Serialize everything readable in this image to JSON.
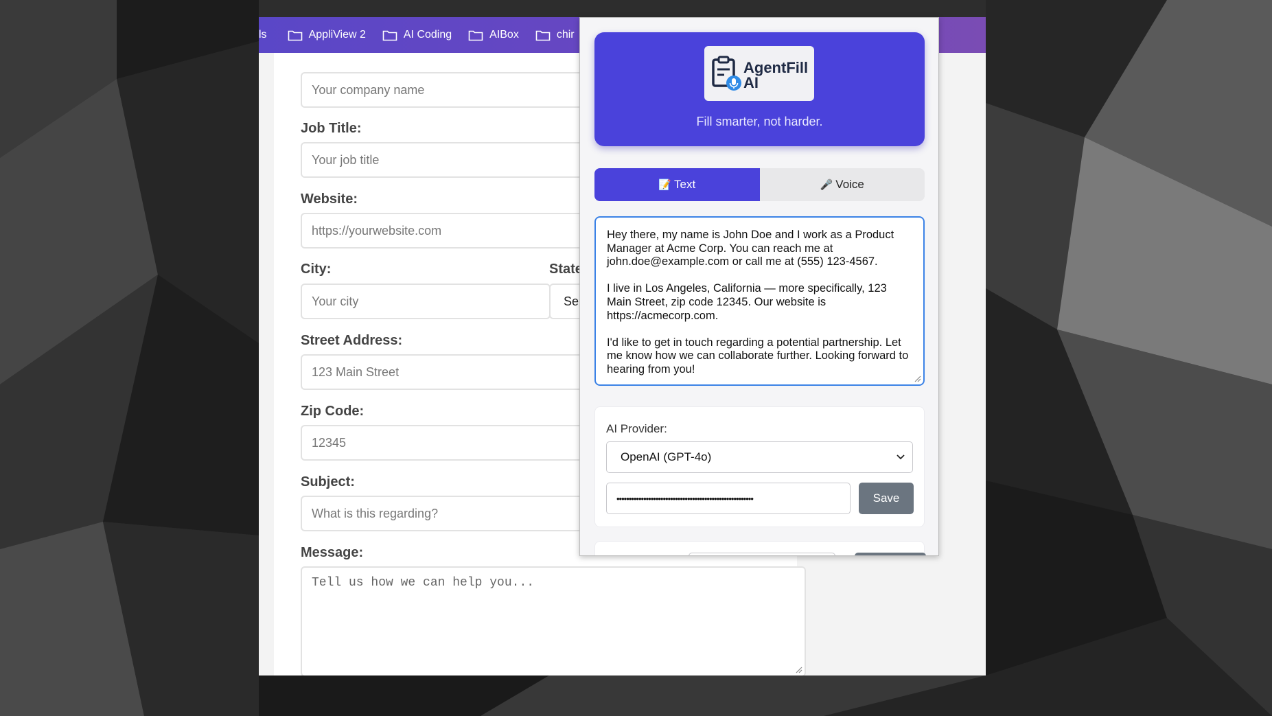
{
  "bookmarks": {
    "partial_first": "ls",
    "items": [
      {
        "label": "AppliView 2"
      },
      {
        "label": "AI Coding"
      },
      {
        "label": "AIBox"
      },
      {
        "label": "chir"
      }
    ]
  },
  "form": {
    "company": {
      "placeholder": "Your company name"
    },
    "job_title": {
      "label": "Job Title:",
      "placeholder": "Your job title"
    },
    "website": {
      "label": "Website:",
      "placeholder": "https://yourwebsite.com"
    },
    "city": {
      "label": "City:",
      "placeholder": "Your city"
    },
    "state": {
      "label": "State",
      "value": "Se"
    },
    "street": {
      "label": "Street Address:",
      "placeholder": "123 Main Street"
    },
    "zip": {
      "label": "Zip Code:",
      "placeholder": "12345"
    },
    "subject": {
      "label": "Subject:",
      "placeholder": "What is this regarding?"
    },
    "message": {
      "label": "Message:",
      "placeholder": "Tell us how we can help you..."
    }
  },
  "popup": {
    "logo_text": "AgentFill AI",
    "tagline": "Fill smarter, not harder.",
    "tabs": [
      {
        "icon": "📝",
        "label": "Text"
      },
      {
        "icon": "🎤",
        "label": "Voice"
      }
    ],
    "prompt_paragraphs": [
      "Hey there, my name is John Doe and I work as a Product Manager at Acme Corp. You can reach me at john.doe@example.com or call me at (555) 123-4567.",
      "I live in Los Angeles, California — more specifically, 123 Main Street, zip code 12345. Our website is https://acmecorp.com.",
      "I'd like to get in touch regarding a potential partnership. Let me know how we can collaborate further. Looking forward to hearing from you!"
    ],
    "provider": {
      "label": "AI Provider:",
      "selected": "OpenAI (GPT-4o)",
      "api_key_masked": "••••••••••••••••••••••••••••••••••••••••••••••••••••••••",
      "save_label": "Save"
    }
  },
  "colors": {
    "accent": "#4a42db",
    "bookmark_bar": "#6a47c0",
    "focus_border": "#3b82e6",
    "button_gray": "#6b7580"
  }
}
